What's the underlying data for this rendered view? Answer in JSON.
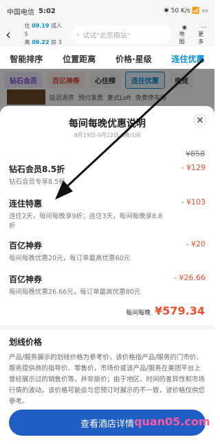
{
  "status": {
    "carrier": "中国电信",
    "time": "5:02",
    "right": "✱ 50 K/s 📶 ▭"
  },
  "top": {
    "checkin_label": "住",
    "checkin": "09.19",
    "checkout_label": "离",
    "checkout": "09.22",
    "adults": "成人 5",
    "rooms": "房 3",
    "search_placeholder": "试试\"北京南站\"",
    "map_label": "地图",
    "more_label": "更多"
  },
  "filters": [
    "智能排序",
    "位置距离",
    "价格·星级",
    "连住优惠"
  ],
  "tags": [
    "钻石会员",
    "百亿神券",
    "心住榜",
    "连住优惠",
    "电竞"
  ],
  "under": [
    "延迟退房",
    "预付发票",
    "复式Loft",
    "免费停车场"
  ],
  "sheet": {
    "title": "每间每晚优惠说明",
    "subtitle": "9月19日-9月22日 3晚/1间",
    "original": "¥858",
    "items": [
      {
        "name": "钻石会员8.5折",
        "amount": "- ¥129",
        "desc": "钻石会员专享8.5折"
      },
      {
        "name": "连住特惠",
        "amount": "- ¥103",
        "desc": "连住2天，每间每晚享9折；连住3天，每间每晚享8.8折"
      },
      {
        "name": "百亿神券",
        "amount": "- ¥20",
        "desc": "每间每晚优惠20元，每订单最高优惠60元"
      },
      {
        "name": "百亿神券",
        "amount": "- ¥26.66",
        "desc": "每间每晚优惠26.66元，每订单最高优惠80元"
      }
    ],
    "total_label": "每间每晚",
    "total_value": "¥579.34",
    "strike_title": "划线价格",
    "strike_text": "产品/服务展示的划线价格为参考价，该价格指产品/服务的门市价、服务提供商的指导价、零售价，市场价或该产品/服务在美团平台上曾经展示过的销售价等，并非原价；由于地区、时间的差异性和市场行情的波动，该价格可能会与您预订时展示的不一致，该价格仅供您参考。",
    "button": "查看酒店详情",
    "watermark": "quan05.com"
  }
}
